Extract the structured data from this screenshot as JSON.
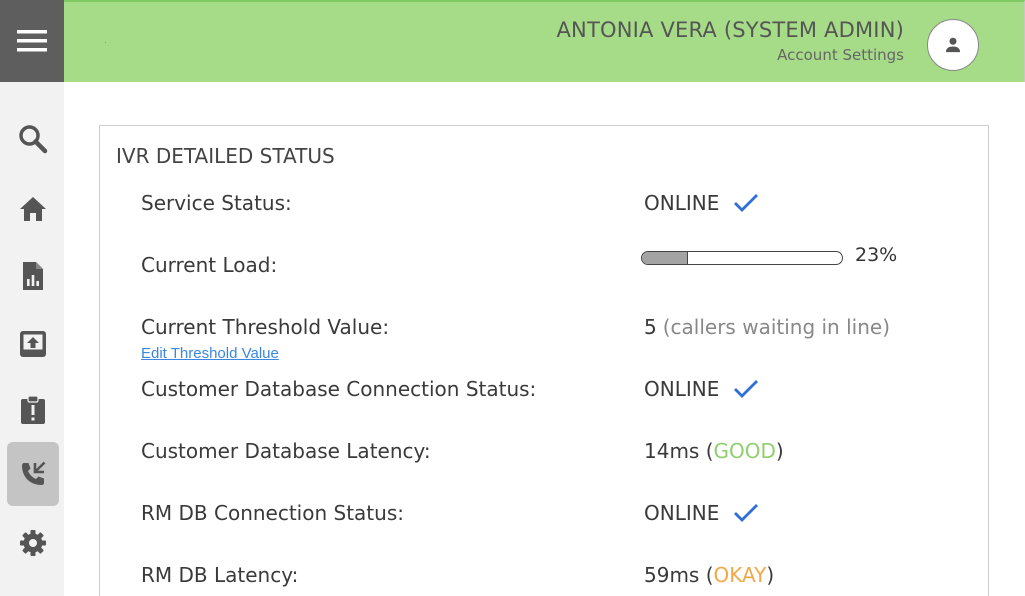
{
  "header": {
    "user_name": "ANTONIA VERA (SYSTEM ADMIN)",
    "account_settings": "Account Settings"
  },
  "sidebar": {
    "items": [
      {
        "icon": "search-icon",
        "active": false
      },
      {
        "icon": "home-icon",
        "active": false
      },
      {
        "icon": "report-icon",
        "active": false
      },
      {
        "icon": "upload-icon",
        "active": false
      },
      {
        "icon": "alert-clipboard-icon",
        "active": false
      },
      {
        "icon": "phone-forward-icon",
        "active": true
      },
      {
        "icon": "gear-icon",
        "active": false
      }
    ]
  },
  "card": {
    "title": "IVR DETAILED STATUS",
    "service_status": {
      "label": "Service Status:",
      "value": "ONLINE"
    },
    "current_load": {
      "label": "Current Load:",
      "percent": 23,
      "text": "23%"
    },
    "threshold": {
      "label": "Current Threshold Value:",
      "value": "5",
      "note": "(callers waiting in line)",
      "edit_link": "Edit Threshold Value"
    },
    "customer_db_status": {
      "label": "Customer Database Connection Status:",
      "value": "ONLINE"
    },
    "customer_db_latency": {
      "label": "Customer Database Latency:",
      "value": "14ms",
      "open": " (",
      "rating": "GOOD",
      "close": ")"
    },
    "rm_db_status": {
      "label": "RM DB Connection Status:",
      "value": "ONLINE"
    },
    "rm_db_latency": {
      "label": "RM DB Latency:",
      "value": "59ms",
      "open": " (",
      "rating": "OKAY",
      "close": ")"
    }
  },
  "colors": {
    "header_bg": "#a6dc88",
    "check": "#2f6fd6",
    "good": "#8fcf6f",
    "okay": "#f3a848",
    "link": "#3a86e0"
  }
}
